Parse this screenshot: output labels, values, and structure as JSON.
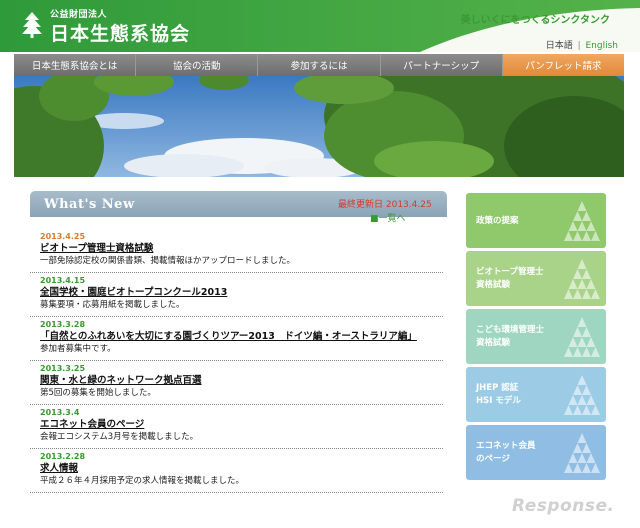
{
  "header": {
    "org_small": "公益財団法人",
    "org_name": "日本生態系協会",
    "tagline": "美しいくにをつくるシンクタンク",
    "lang_ja": "日本語",
    "lang_sep": "|",
    "lang_en": "English"
  },
  "nav": [
    "日本生態系協会とは",
    "協会の活動",
    "参加するには",
    "パートナーシップ",
    "パンフレット請求"
  ],
  "whats_new": {
    "title": "What's New",
    "updated": "最終更新日 2013.4.25",
    "all_link": "■一覧へ"
  },
  "news": [
    {
      "date": "2013.4.25",
      "title": "ビオトープ管理士資格試験",
      "desc": "一部免除認定校の関係書類、掲載情報ほかアップロードしました。"
    },
    {
      "date": "2013.4.15",
      "title": "全国学校・園庭ビオトープコンクール2013",
      "desc": "募集要項・応募用紙を掲載しました。"
    },
    {
      "date": "2013.3.28",
      "title": "「自然とのふれあいを大切にする園づくりツアー2013　ドイツ編・オーストラリア編」",
      "desc": "参加者募集中です。"
    },
    {
      "date": "2013.3.25",
      "title": "関東・水と緑のネットワーク拠点百選",
      "desc": "第5回の募集を開始しました。"
    },
    {
      "date": "2013.3.4",
      "title": "エコネット会員のページ",
      "desc": "会報エコシステム3月号を掲載しました。"
    },
    {
      "date": "2013.2.28",
      "title": "求人情報",
      "desc": "平成２６年４月採用予定の求人情報を掲載しました。"
    }
  ],
  "side_buttons": [
    {
      "lines": [
        "政策の提案"
      ],
      "color": "#8fc96b"
    },
    {
      "lines": [
        "ビオトープ管理士",
        "資格試験"
      ],
      "color": "#a9d389"
    },
    {
      "lines": [
        "こども環境管理士",
        "資格試験"
      ],
      "color": "#9fd6c2"
    },
    {
      "lines": [
        "JHEP 認証",
        "HSI モデル"
      ],
      "color": "#9ccbe6"
    },
    {
      "lines": [
        "エコネット会員",
        "のページ"
      ],
      "color": "#8fbde4"
    }
  ],
  "watermark": "Response."
}
